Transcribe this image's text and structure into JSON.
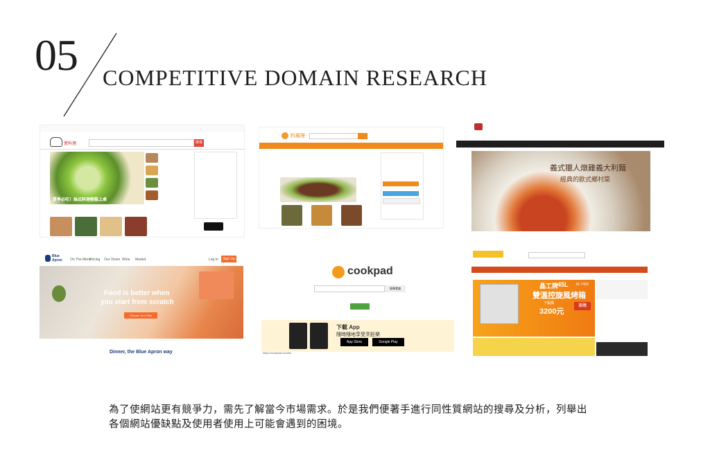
{
  "header": {
    "number": "05",
    "title": "COMPETITIVE DOMAIN RESEARCH"
  },
  "screens": {
    "s1": {
      "logo_text": "愛料理",
      "hero_caption": "夏季必吃！絲瓜料理輕鬆上桌",
      "search_button": "搜尋"
    },
    "s2": {
      "logo_text": "料羅理"
    },
    "s3": {
      "hero_line1": "義式獵人燉雞義大利麵",
      "hero_line2": "經典的歐式鄉村菜"
    },
    "s4": {
      "brand_line1": "Blue",
      "brand_line2": "Apron",
      "nav": [
        "On The Menu",
        "Pricing",
        "Our Vision",
        "Wine",
        "Market"
      ],
      "login": "Log In",
      "signup": "Sign Up",
      "hero_line1": "Food is better when",
      "hero_line2": "you start from scratch",
      "hero_button": "Choose Your Plan",
      "footer_heading": "Dinner, the Blue Apron way"
    },
    "s5": {
      "logo_text": "cookpad",
      "search_button": "搜尋食譜",
      "app_title": "下載 App",
      "app_subtitle": "隨時隨地享受烹飪樂",
      "app_store": "App Store",
      "google_play": "Google Play",
      "url": "https://cookpad.com/tw"
    },
    "s6": {
      "product_brand": "晶工牌",
      "product_size": "45L",
      "product_model": "JK-7450",
      "product_name": "雙溫控旋風烤箱",
      "price": "3200元",
      "price_label": "下殺價",
      "buy_button": "搶購"
    }
  },
  "caption": {
    "line1": "為了使網站更有競爭力，需先了解當今市場需求。於是我們便著手進行同性質網站的搜尋及分析，列舉出",
    "line2": "各個網站優缺點及使用者使用上可能會遇到的困境。"
  }
}
